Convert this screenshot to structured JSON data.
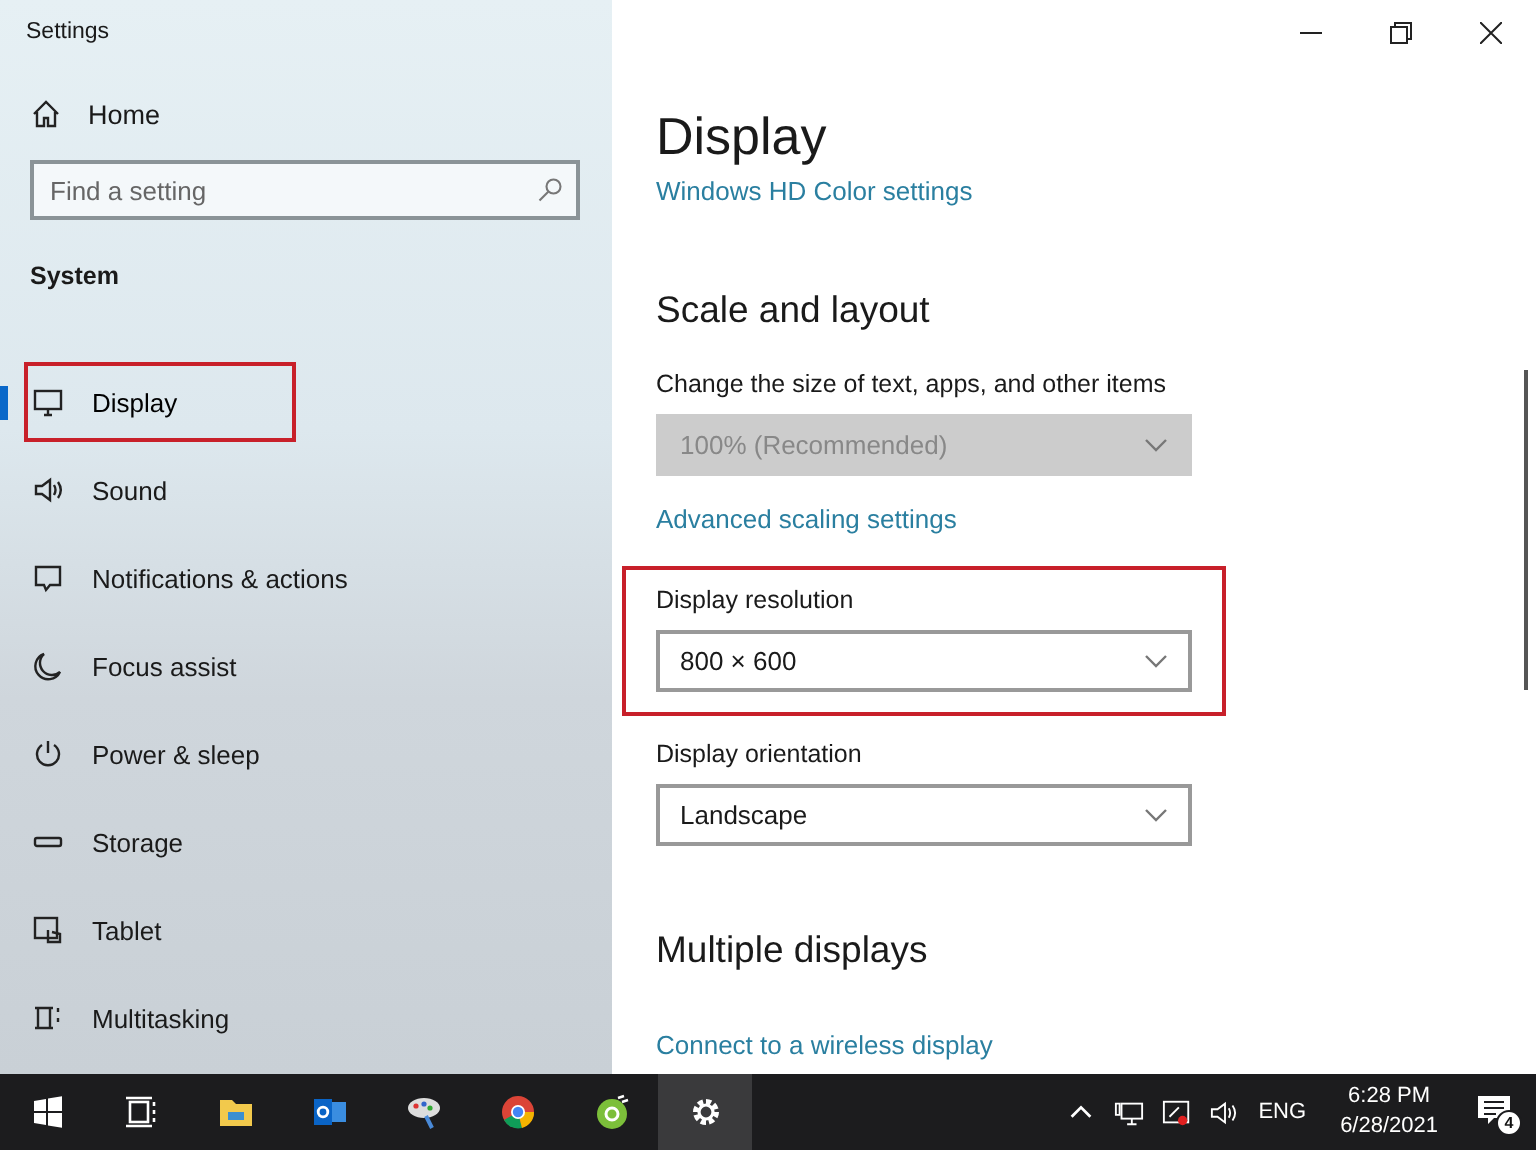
{
  "window": {
    "title": "Settings"
  },
  "sidebar": {
    "home": "Home",
    "search": {
      "placeholder": "Find a setting"
    },
    "section": "System",
    "items": [
      {
        "label": "Display",
        "selected": true,
        "highlighted": true
      },
      {
        "label": "Sound",
        "selected": false,
        "highlighted": false
      },
      {
        "label": "Notifications & actions",
        "selected": false,
        "highlighted": false
      },
      {
        "label": "Focus assist",
        "selected": false,
        "highlighted": false
      },
      {
        "label": "Power & sleep",
        "selected": false,
        "highlighted": false
      },
      {
        "label": "Storage",
        "selected": false,
        "highlighted": false
      },
      {
        "label": "Tablet",
        "selected": false,
        "highlighted": false
      },
      {
        "label": "Multitasking",
        "selected": false,
        "highlighted": false
      }
    ]
  },
  "content": {
    "title": "Display",
    "blocks": [
      {
        "kind": "link",
        "text": "Windows HD Color settings"
      },
      {
        "kind": "heading",
        "text": "Scale and layout"
      },
      {
        "kind": "field",
        "label": "Change the size of text, apps, and other items",
        "value": "100% (Recommended)",
        "disabled": true,
        "highlighted": false
      },
      {
        "kind": "link",
        "text": "Advanced scaling settings"
      },
      {
        "kind": "field",
        "label": "Display resolution",
        "value": "800 × 600",
        "disabled": false,
        "highlighted": true
      },
      {
        "kind": "field",
        "label": "Display orientation",
        "value": "Landscape",
        "disabled": false,
        "highlighted": false
      },
      {
        "kind": "heading",
        "text": "Multiple displays"
      },
      {
        "kind": "link",
        "text": "Connect to a wireless display"
      }
    ]
  },
  "taskbar": {
    "apps": [
      {
        "active": false
      },
      {
        "active": false
      },
      {
        "active": false
      },
      {
        "active": false
      },
      {
        "active": false
      },
      {
        "active": false
      },
      {
        "active": false
      },
      {
        "active": true
      }
    ],
    "language": "ENG",
    "time": "6:28 PM",
    "date": "6/28/2021",
    "notification_count": "4"
  }
}
